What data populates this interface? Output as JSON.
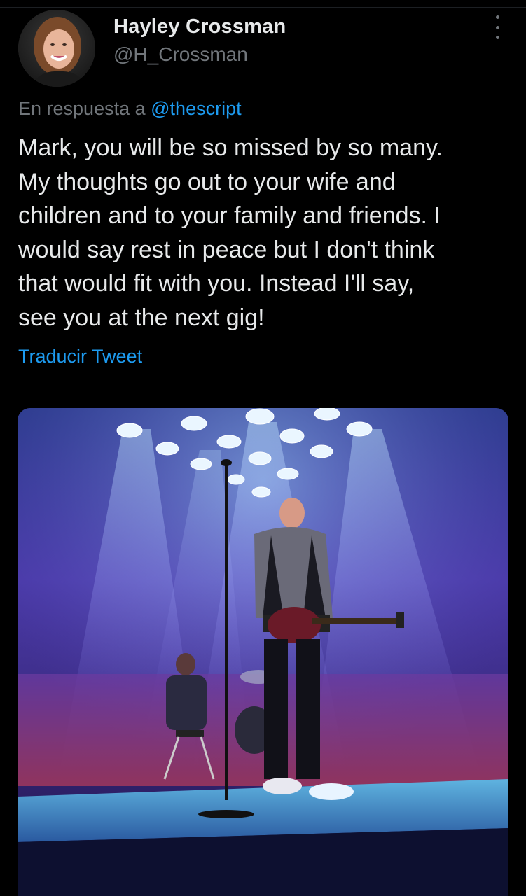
{
  "author": {
    "display_name": "Hayley Crossman",
    "handle": "@H_Crossman"
  },
  "reply": {
    "prefix": "En respuesta a",
    "mention": "@thescript"
  },
  "tweet": {
    "lines": [
      "Mark, you will be so missed by so many.",
      "My thoughts go out to your wife and",
      "children and to your family and friends. I",
      "would say rest in peace but I don't think",
      "that would fit with you. Instead I'll say,",
      "see you at the next gig!"
    ]
  },
  "translate_label": "Traducir Tweet",
  "icons": {
    "more": "more-vertical-icon"
  },
  "colors": {
    "background": "#000000",
    "text_primary": "#e7e9ea",
    "text_secondary": "#71767b",
    "link": "#1d9bf0"
  }
}
